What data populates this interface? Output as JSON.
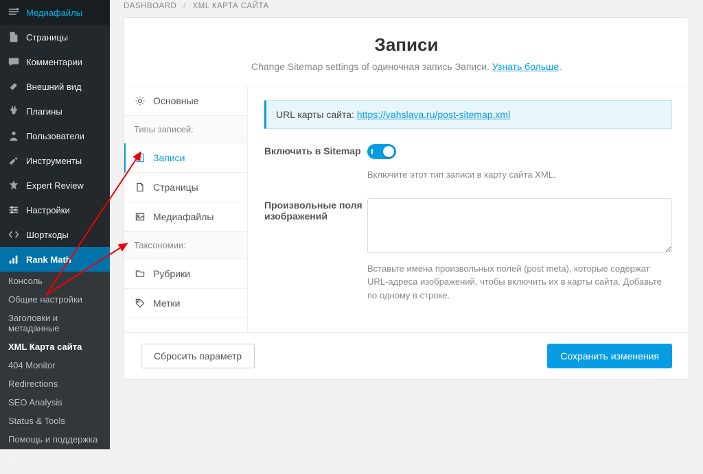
{
  "sidebar": {
    "items": [
      {
        "label": "Медиафайлы",
        "icon": "media"
      },
      {
        "label": "Страницы",
        "icon": "page"
      },
      {
        "label": "Комментарии",
        "icon": "comment"
      },
      {
        "label": "Внешний вид",
        "icon": "appearance"
      },
      {
        "label": "Плагины",
        "icon": "plugins"
      },
      {
        "label": "Пользователи",
        "icon": "users"
      },
      {
        "label": "Инструменты",
        "icon": "tools"
      },
      {
        "label": "Expert Review",
        "icon": "star"
      },
      {
        "label": "Настройки",
        "icon": "settings"
      },
      {
        "label": "Шорткоды",
        "icon": "code"
      },
      {
        "label": "Rank Math",
        "icon": "chart",
        "active": true
      },
      {
        "label": "Clearfy Pro",
        "icon": "diamond"
      }
    ],
    "subitems": [
      {
        "label": "Консоль"
      },
      {
        "label": "Общие настройки"
      },
      {
        "label": "Заголовки и метаданные"
      },
      {
        "label": "XML Карта сайта",
        "active": true
      },
      {
        "label": "404 Monitor"
      },
      {
        "label": "Redirections"
      },
      {
        "label": "SEO Analysis"
      },
      {
        "label": "Status & Tools"
      },
      {
        "label": "Помощь и поддержка"
      }
    ]
  },
  "breadcrumb": {
    "a": "DASHBOARD",
    "b": "XML КАРТА САЙТА"
  },
  "panel": {
    "title": "Записи",
    "desc_pre": "Change Sitemap settings of одиночная запись Записи. ",
    "desc_link": "Узнать больше",
    "tabs": {
      "basic": "Основные",
      "header_types": "Типы записей:",
      "posts": "Записи",
      "pages": "Страницы",
      "media": "Медиафайлы",
      "header_tax": "Таксономии:",
      "categories": "Рубрики",
      "tags": "Метки"
    },
    "notice_label": "URL карты сайта: ",
    "notice_url": "https://vahslava.ru/post-sitemap.xml",
    "field1": {
      "label": "Включить в Sitemap",
      "help": "Включите этот тип записи в карту сайта XML."
    },
    "field2": {
      "label": "Произвольные поля изображений",
      "help": "Вставьте имена произвольных полей (post meta), которые содержат URL-адреса изображений, чтобы включить их в карты сайта. Добавьте по одному в строке."
    },
    "reset": "Сбросить параметр",
    "save": "Сохранить изменения"
  }
}
